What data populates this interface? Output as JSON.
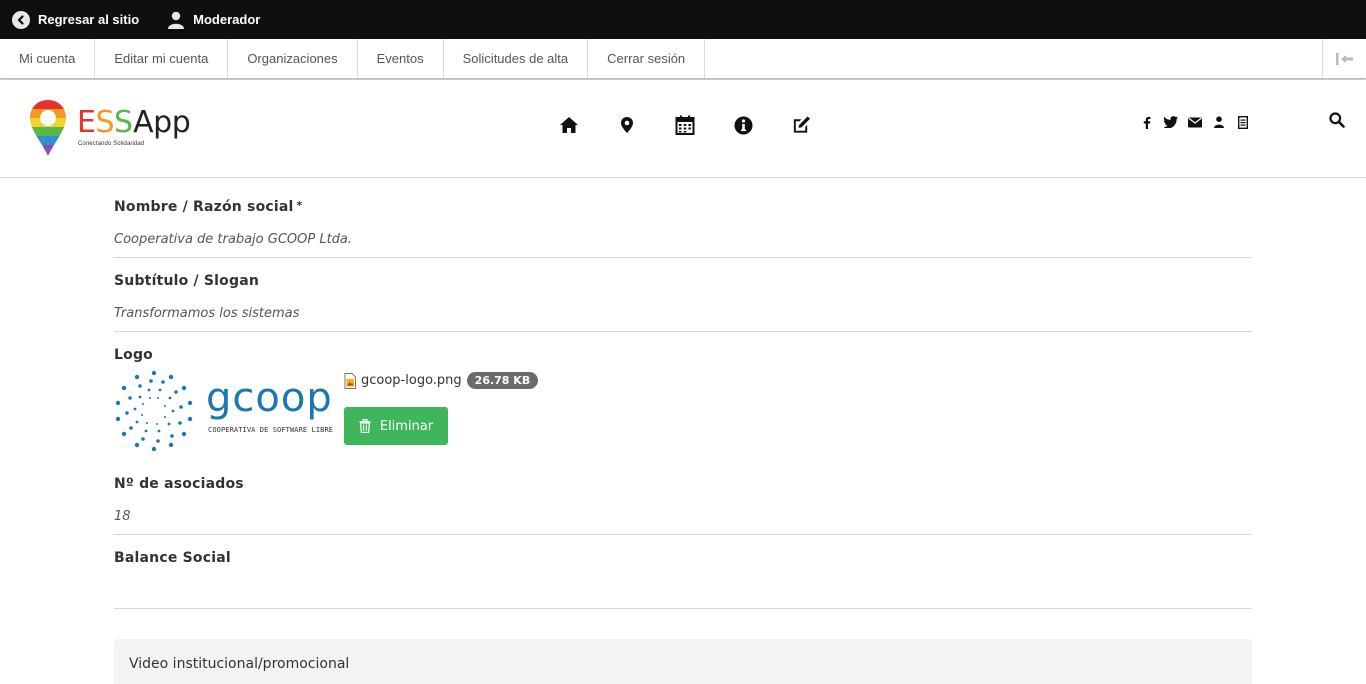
{
  "toolbar": {
    "back_label": "Regresar al sitio",
    "user_label": "Moderador"
  },
  "tray": {
    "tabs": [
      {
        "label": "Mi cuenta"
      },
      {
        "label": "Editar mi cuenta"
      },
      {
        "label": "Organizaciones"
      },
      {
        "label": "Eventos"
      },
      {
        "label": "Solicitudes de alta"
      },
      {
        "label": "Cerrar sesión"
      }
    ]
  },
  "site": {
    "logo": {
      "name_e": "E",
      "name_s1": "S",
      "name_s2": "S",
      "name_app": "App",
      "tagline": "Conectando Solidaridad"
    },
    "nav_icons": [
      "home-icon",
      "map-marker-icon",
      "calendar-icon",
      "info-icon",
      "edit-icon"
    ],
    "social_icons": [
      "facebook-icon",
      "twitter-icon",
      "envelope-icon",
      "user-icon",
      "document-icon"
    ],
    "accent_colors": {
      "red": "#e4322f",
      "orange": "#f29a1f",
      "green": "#57b847",
      "button_green": "#3fb65a"
    }
  },
  "form": {
    "name": {
      "label": "Nombre / Razón social",
      "required_mark": "*",
      "value": "Cooperativa de trabajo GCOOP Ltda."
    },
    "subtitle": {
      "label": "Subtítulo / Slogan",
      "value": "Transformamos los sistemas"
    },
    "logo": {
      "label": "Logo",
      "image_text": "gcoop",
      "image_caption": "COOPERATIVA DE SOFTWARE LIBRE",
      "file_name": "gcoop-logo.png",
      "file_size": "26.78 KB",
      "delete_label": "Eliminar"
    },
    "members": {
      "label": "Nº de asociados",
      "value": "18"
    },
    "social_balance": {
      "label": "Balance Social"
    },
    "video_panel": {
      "label": "Video institucional/promocional"
    }
  }
}
